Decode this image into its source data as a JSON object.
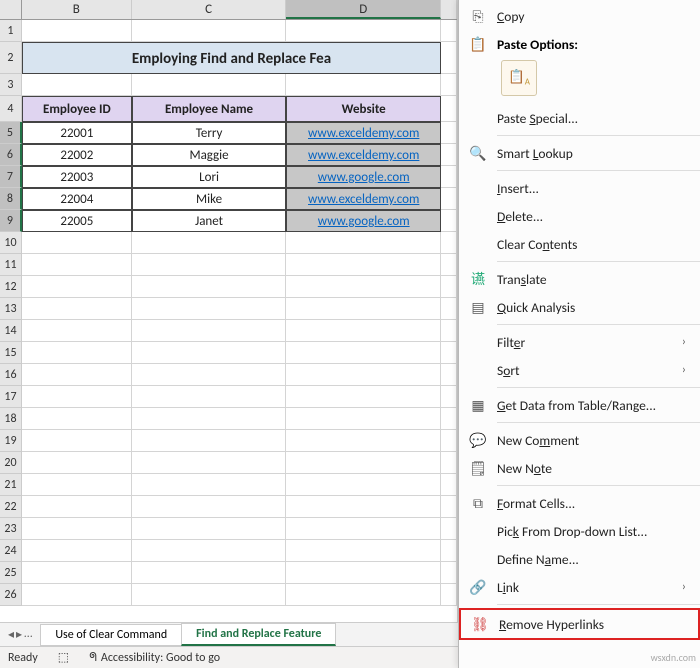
{
  "title": "Employing Find and Replace Fea",
  "columns": [
    "B",
    "C",
    "D"
  ],
  "headers": {
    "id": "Employee ID",
    "name": "Employee Name",
    "web": "Website"
  },
  "rows": [
    {
      "id": "22001",
      "name": "Terry",
      "web": "www.exceldemy.com"
    },
    {
      "id": "22002",
      "name": "Maggie",
      "web": "www.exceldemy.com"
    },
    {
      "id": "22003",
      "name": "Lori",
      "web": "www.google.com"
    },
    {
      "id": "22004",
      "name": "Mike",
      "web": "www.exceldemy.com"
    },
    {
      "id": "22005",
      "name": "Janet",
      "web": "www.google.com"
    }
  ],
  "sheet_tabs": {
    "inactive": "Use of Clear Command",
    "active": "Find and Replace Feature"
  },
  "status": {
    "ready": "Ready",
    "access": "Accessibility: Good to go"
  },
  "menu": {
    "copy": "Copy",
    "paste_options": "Paste Options:",
    "paste_special": "Paste Special...",
    "smart_lookup": "Smart Lookup",
    "insert": "Insert...",
    "delete": "Delete...",
    "clear": "Clear Contents",
    "translate": "Translate",
    "quick": "Quick Analysis",
    "filter": "Filter",
    "sort": "Sort",
    "get_data": "Get Data from Table/Range...",
    "comment": "New Comment",
    "note": "New Note",
    "format": "Format Cells...",
    "pick": "Pick From Drop-down List...",
    "define": "Define Name...",
    "link": "Link",
    "remove_hyper": "Remove Hyperlinks"
  },
  "watermark": "wsxdn.com"
}
